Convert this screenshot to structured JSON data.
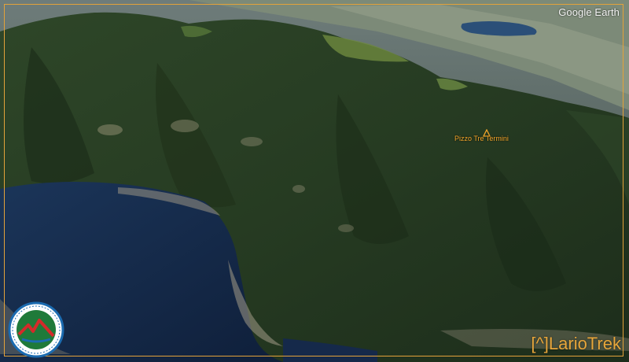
{
  "map": {
    "provider": "Google Earth",
    "peak_label": "Pizzo Tre Termini",
    "peak_icon": "mountain-peak-icon"
  },
  "watermark": {
    "brand": "[^]LarioTrek"
  },
  "colors": {
    "frame": "#e3a23a",
    "label": "#f2a52a",
    "lake": "#142745",
    "forest": "#2a3f24"
  }
}
